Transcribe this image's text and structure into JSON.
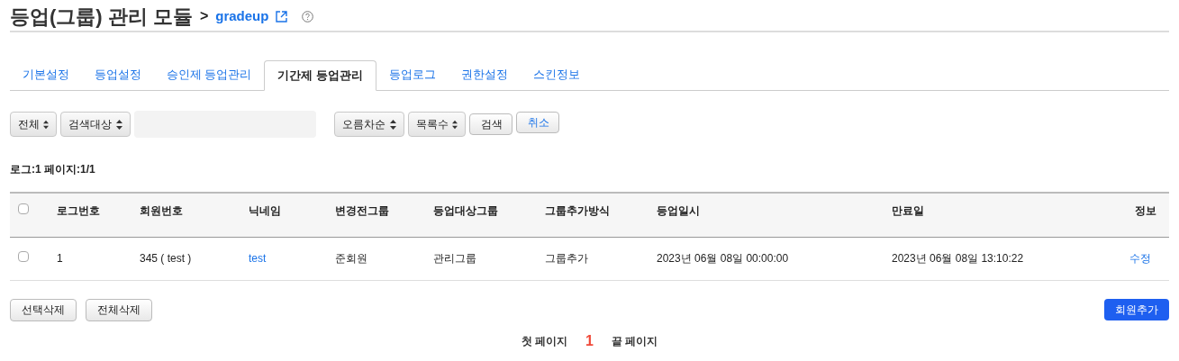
{
  "header": {
    "title": "등업(그룹) 관리 모듈",
    "separator": ">",
    "module_link": "gradeup"
  },
  "tabs": [
    {
      "label": "기본설정",
      "selected": false
    },
    {
      "label": "등업설정",
      "selected": false
    },
    {
      "label": "승인제 등업관리",
      "selected": false
    },
    {
      "label": "기간제 등업관리",
      "selected": true
    },
    {
      "label": "등업로그",
      "selected": false
    },
    {
      "label": "권한설정",
      "selected": false
    },
    {
      "label": "스킨정보",
      "selected": false
    }
  ],
  "filters": {
    "scope": "전체",
    "target": "검색대상",
    "order": "오름차순",
    "count": "목록수",
    "search_button": "검색",
    "cancel_button": "취소"
  },
  "summary": "로그:1 페이지:1/1",
  "table": {
    "columns": [
      "로그번호",
      "회원번호",
      "닉네임",
      "변경전그룹",
      "등업대상그룹",
      "그룹추가방식",
      "등업일시",
      "만료일",
      "정보"
    ],
    "header_checked": false,
    "rows": [
      {
        "checked": false,
        "cells": [
          "1",
          "345 ( test )",
          "test",
          "준회원",
          "관리그룹",
          "그룹추가",
          "2023년 06월 08일 00:00:00",
          "2023년 06월 08일 13:10:22",
          "수정"
        ]
      }
    ]
  },
  "actions": {
    "delete_selected": "선택삭제",
    "delete_all": "전체삭제",
    "add_member": "회원추가"
  },
  "pagination": {
    "first": "첫 페이지",
    "pages": [
      {
        "label": "1",
        "selected": true
      }
    ],
    "last": "끝 페이지"
  }
}
